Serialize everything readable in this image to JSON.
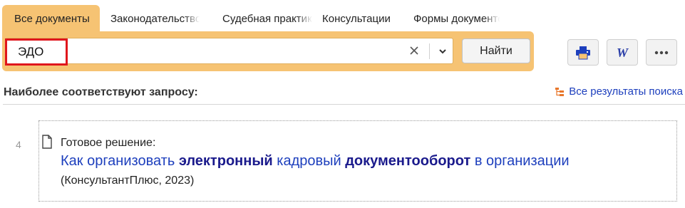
{
  "tabs": [
    {
      "label": "Все документы",
      "active": true
    },
    {
      "label": "Законодательство",
      "active": false
    },
    {
      "label": "Судебная практика",
      "active": false
    },
    {
      "label": "Консультации",
      "active": false
    },
    {
      "label": "Формы документов",
      "active": false
    }
  ],
  "search": {
    "value": "ЭДО",
    "find_label": "Найти"
  },
  "results": {
    "heading": "Наиболее соответствуют запросу:",
    "all_results_label": "Все результаты поиска",
    "items": [
      {
        "number": "4",
        "type": "Готовое решение:",
        "title_parts": [
          {
            "text": "Как организовать ",
            "bold": false
          },
          {
            "text": "электронный",
            "bold": true
          },
          {
            "text": " кадровый ",
            "bold": false
          },
          {
            "text": "документооборот",
            "bold": true
          },
          {
            "text": " в организации",
            "bold": false
          }
        ],
        "source": "(КонсультантПлюс, 2023)"
      }
    ]
  },
  "colors": {
    "accent": "#f6c373",
    "link": "#1d3fbd",
    "link_bold": "#1a1a8c",
    "highlight_border": "#e0161c"
  },
  "icons": {
    "clear": "close-icon",
    "dropdown": "chevron-down-icon",
    "print": "printer-icon",
    "word": "word-export-icon",
    "more": "more-dots-icon",
    "all_results": "tree-list-icon",
    "document": "document-icon"
  }
}
